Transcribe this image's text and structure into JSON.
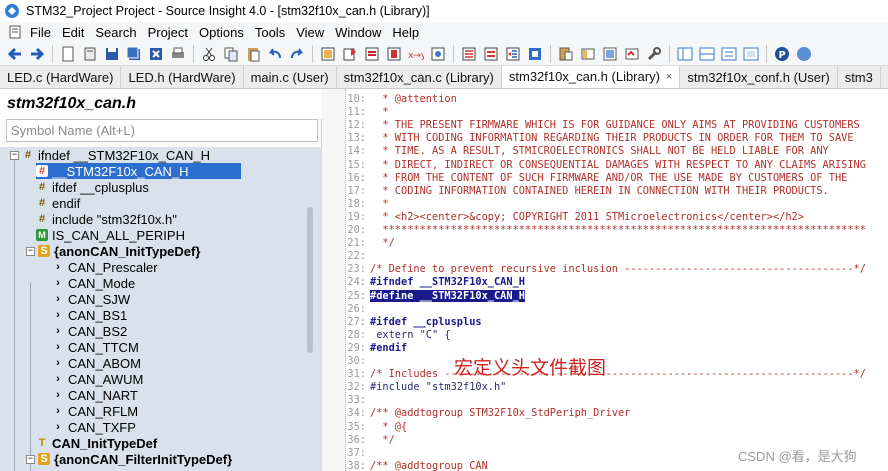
{
  "window": {
    "title": "STM32_Project Project - Source Insight 4.0 - [stm32f10x_can.h (Library)]"
  },
  "menu": {
    "items": [
      "File",
      "Edit",
      "Search",
      "Project",
      "Options",
      "Tools",
      "View",
      "Window",
      "Help"
    ]
  },
  "tabs": [
    {
      "label": "LED.c (HardWare)"
    },
    {
      "label": "LED.h (HardWare)"
    },
    {
      "label": "main.c (User)"
    },
    {
      "label": "stm32f10x_can.c (Library)"
    },
    {
      "label": "stm32f10x_can.h (Library)",
      "close": "×"
    },
    {
      "label": "stm32f10x_conf.h (User)"
    },
    {
      "label": "stm3"
    }
  ],
  "symbol_panel": {
    "title": "stm32f10x_can.h",
    "search_placeholder": "Symbol Name (Alt+L)",
    "tree": [
      {
        "label": "ifndef __STM32F10x_CAN_H",
        "icon": "hash-icon",
        "expander": "−"
      },
      {
        "label": "__STM32F10x_CAN_H",
        "icon": "define-icon"
      },
      {
        "label": "ifdef __cplusplus",
        "icon": "hash-icon"
      },
      {
        "label": "endif",
        "icon": "hash-icon"
      },
      {
        "label": "include \"stm32f10x.h\"",
        "icon": "hash-icon"
      },
      {
        "label": "IS_CAN_ALL_PERIPH",
        "icon": "macro-icon"
      },
      {
        "label": "{anonCAN_InitTypeDef}",
        "icon": "struct-icon",
        "expander": "−"
      },
      {
        "label": "CAN_Prescaler",
        "icon": "member-icon"
      },
      {
        "label": "CAN_Mode",
        "icon": "member-icon"
      },
      {
        "label": "CAN_SJW",
        "icon": "member-icon"
      },
      {
        "label": "CAN_BS1",
        "icon": "member-icon"
      },
      {
        "label": "CAN_BS2",
        "icon": "member-icon"
      },
      {
        "label": "CAN_TTCM",
        "icon": "member-icon"
      },
      {
        "label": "CAN_ABOM",
        "icon": "member-icon"
      },
      {
        "label": "CAN_AWUM",
        "icon": "member-icon"
      },
      {
        "label": "CAN_NART",
        "icon": "member-icon"
      },
      {
        "label": "CAN_RFLM",
        "icon": "member-icon"
      },
      {
        "label": "CAN_TXFP",
        "icon": "member-icon"
      },
      {
        "label": "CAN_InitTypeDef",
        "icon": "typedef-icon"
      },
      {
        "label": "{anonCAN_FilterInitTypeDef}",
        "icon": "struct-icon",
        "expander": "−"
      }
    ]
  },
  "editor": {
    "lines": [
      {
        "n": "10:",
        "text": "  * @attention",
        "style": "cmt"
      },
      {
        "n": "11:",
        "text": "  *",
        "style": "cmt"
      },
      {
        "n": "12:",
        "text": "  * THE PRESENT FIRMWARE WHICH IS FOR GUIDANCE ONLY AIMS AT PROVIDING CUSTOMERS",
        "style": "cmt"
      },
      {
        "n": "13:",
        "text": "  * WITH CODING INFORMATION REGARDING THEIR PRODUCTS IN ORDER FOR THEM TO SAVE",
        "style": "cmt"
      },
      {
        "n": "14:",
        "text": "  * TIME. AS A RESULT, STMICROELECTRONICS SHALL NOT BE HELD LIABLE FOR ANY",
        "style": "cmt"
      },
      {
        "n": "15:",
        "text": "  * DIRECT, INDIRECT OR CONSEQUENTIAL DAMAGES WITH RESPECT TO ANY CLAIMS ARISING",
        "style": "cmt"
      },
      {
        "n": "16:",
        "text": "  * FROM THE CONTENT OF SUCH FIRMWARE AND/OR THE USE MADE BY CUSTOMERS OF THE",
        "style": "cmt"
      },
      {
        "n": "17:",
        "text": "  * CODING INFORMATION CONTAINED HEREIN IN CONNECTION WITH THEIR PRODUCTS.",
        "style": "cmt"
      },
      {
        "n": "18:",
        "text": "  *",
        "style": "cmt"
      },
      {
        "n": "19:",
        "text": "  * <h2><center>&copy; COPYRIGHT 2011 STMicroelectronics</center></h2>",
        "style": "cmt"
      },
      {
        "n": "20:",
        "text": "  ******************************************************************************",
        "style": "cmt"
      },
      {
        "n": "21:",
        "text": "  */",
        "style": "cmt"
      },
      {
        "n": "22:",
        "text": "",
        "style": "cmt"
      },
      {
        "n": "23:",
        "text": "/* Define to prevent recursive inclusion -------------------------------------*/",
        "style": "cmt"
      },
      {
        "n": "24:",
        "text": "#ifndef __STM32F10x_CAN_H",
        "style": "kw"
      },
      {
        "n": "25:",
        "text": "#define __STM32F10x_CAN_H",
        "style": "hl"
      },
      {
        "n": "26:",
        "text": "",
        "style": "cmt"
      },
      {
        "n": "27:",
        "text": "#ifdef __cplusplus",
        "style": "kw"
      },
      {
        "n": "28:",
        "text": " extern \"C\" {",
        "style": "str"
      },
      {
        "n": "29:",
        "text": "#endif",
        "style": "kw"
      },
      {
        "n": "30:",
        "text": "",
        "style": "cmt"
      },
      {
        "n": "31:",
        "text": "/* Includes ------------------------------------------------------------------*/",
        "style": "cmt"
      },
      {
        "n": "32:",
        "text": "#include \"stm32f10x.h\"",
        "style": "inc"
      },
      {
        "n": "33:",
        "text": "",
        "style": "cmt"
      },
      {
        "n": "34:",
        "text": "/** @addtogroup STM32F10x_StdPeriph_Driver",
        "style": "cmt"
      },
      {
        "n": "35:",
        "text": "  * @{",
        "style": "cmt"
      },
      {
        "n": "36:",
        "text": "  */",
        "style": "cmt"
      },
      {
        "n": "37:",
        "text": "",
        "style": "cmt"
      },
      {
        "n": "38:",
        "text": "/** @addtogroup CAN",
        "style": "cmt"
      }
    ],
    "annotation": "宏定义头文件截图",
    "watermark": "CSDN @看，是大狗"
  },
  "colors": {
    "selection": "#2a6fcf",
    "tree_bg": "#d9e1ec",
    "comment": "#b0302a",
    "keyword": "#1a1a8c",
    "annotation": "#d0211c"
  }
}
